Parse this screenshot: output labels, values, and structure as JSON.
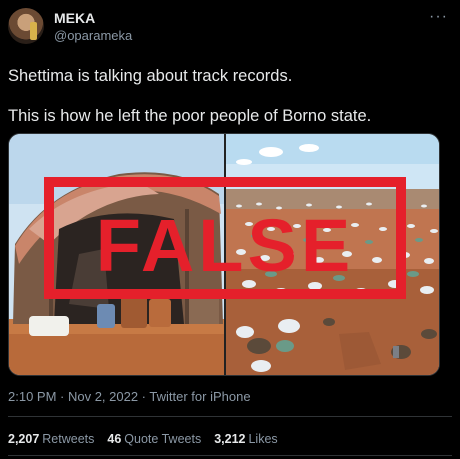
{
  "tweet": {
    "author_name": "MEKA",
    "author_handle": "@oparameka",
    "more_icon": "more-horizontal-icon",
    "text_line_1": "Shettima is talking about track records.",
    "text_line_2": "This is how he left the poor people of Borno state.",
    "media": {
      "overlay_stamp": "FALSE",
      "stamp_color": "#e5202b",
      "left_photo": "makeshift shelter hut",
      "right_photo": "aerial view of displacement camp"
    },
    "timestamp": "2:10 PM · Nov 2, 2022 · Twitter for iPhone",
    "retweets_count": "2,207",
    "retweets_label": "Retweets",
    "quotes_count": "46",
    "quotes_label": "Quote Tweets",
    "likes_count": "3,212",
    "likes_label": "Likes"
  }
}
